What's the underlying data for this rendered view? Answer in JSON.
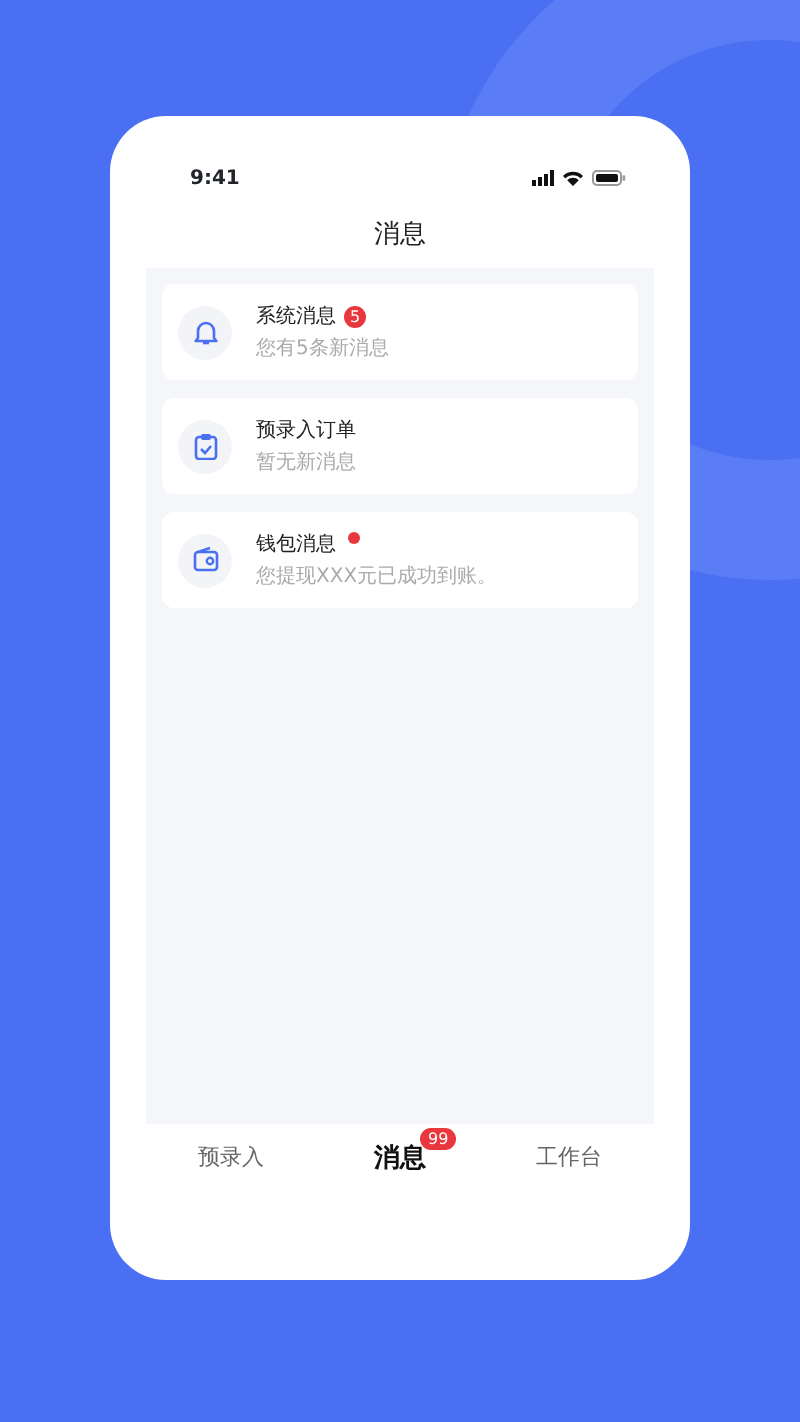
{
  "status_bar": {
    "time": "9:41"
  },
  "header": {
    "title": "消息"
  },
  "messages": [
    {
      "kind": "bell",
      "title": "系统消息",
      "badge": {
        "kind": "count",
        "text": "5"
      },
      "subtitle": "您有5条新消息"
    },
    {
      "kind": "clipboard",
      "title": "预录入订单",
      "badge": {
        "kind": "none"
      },
      "subtitle": "暂无新消息"
    },
    {
      "kind": "wallet",
      "title": "钱包消息",
      "badge": {
        "kind": "dot"
      },
      "subtitle": "您提现XXX元已成功到账。"
    }
  ],
  "tabs": [
    {
      "label": "预录入",
      "selected": false
    },
    {
      "label": "消息",
      "selected": true,
      "badge": "99"
    },
    {
      "label": "工作台",
      "selected": false
    }
  ]
}
